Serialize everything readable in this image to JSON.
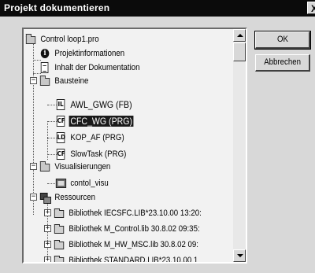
{
  "window": {
    "title": "Projekt dokumentieren",
    "close_label": "X"
  },
  "buttons": {
    "ok_label": "OK",
    "cancel_label": "Abbrechen"
  },
  "tree": {
    "root": "Control loop1.pro",
    "projektinfo": "Projektinformationen",
    "inhalt": "Inhalt der Dokumentation",
    "bausteine": "Bausteine",
    "bausteine_items": [
      "AWL_GWG (FB)",
      "CFC_WG (PRG)",
      "KOP_AF (PRG)",
      "SlowTask (PRG)"
    ],
    "bausteine_icons": [
      "IL",
      "CF",
      "LD",
      "CF"
    ],
    "visualisierungen": "Visualisierungen",
    "visu_item": "contol_visu",
    "ressourcen": "Ressourcen",
    "ressourcen_items": [
      "Bibliothek IECSFC.LIB*23.10.00 13:20:",
      "Bibliothek M_Control.lib 30.8.02 09:35:",
      "Bibliothek M_HW_MSC.lib 30.8.02 09:",
      "Bibliothek STANDARD.LIB*23.10.00 1"
    ],
    "selected": "CFC_WG (PRG)"
  }
}
